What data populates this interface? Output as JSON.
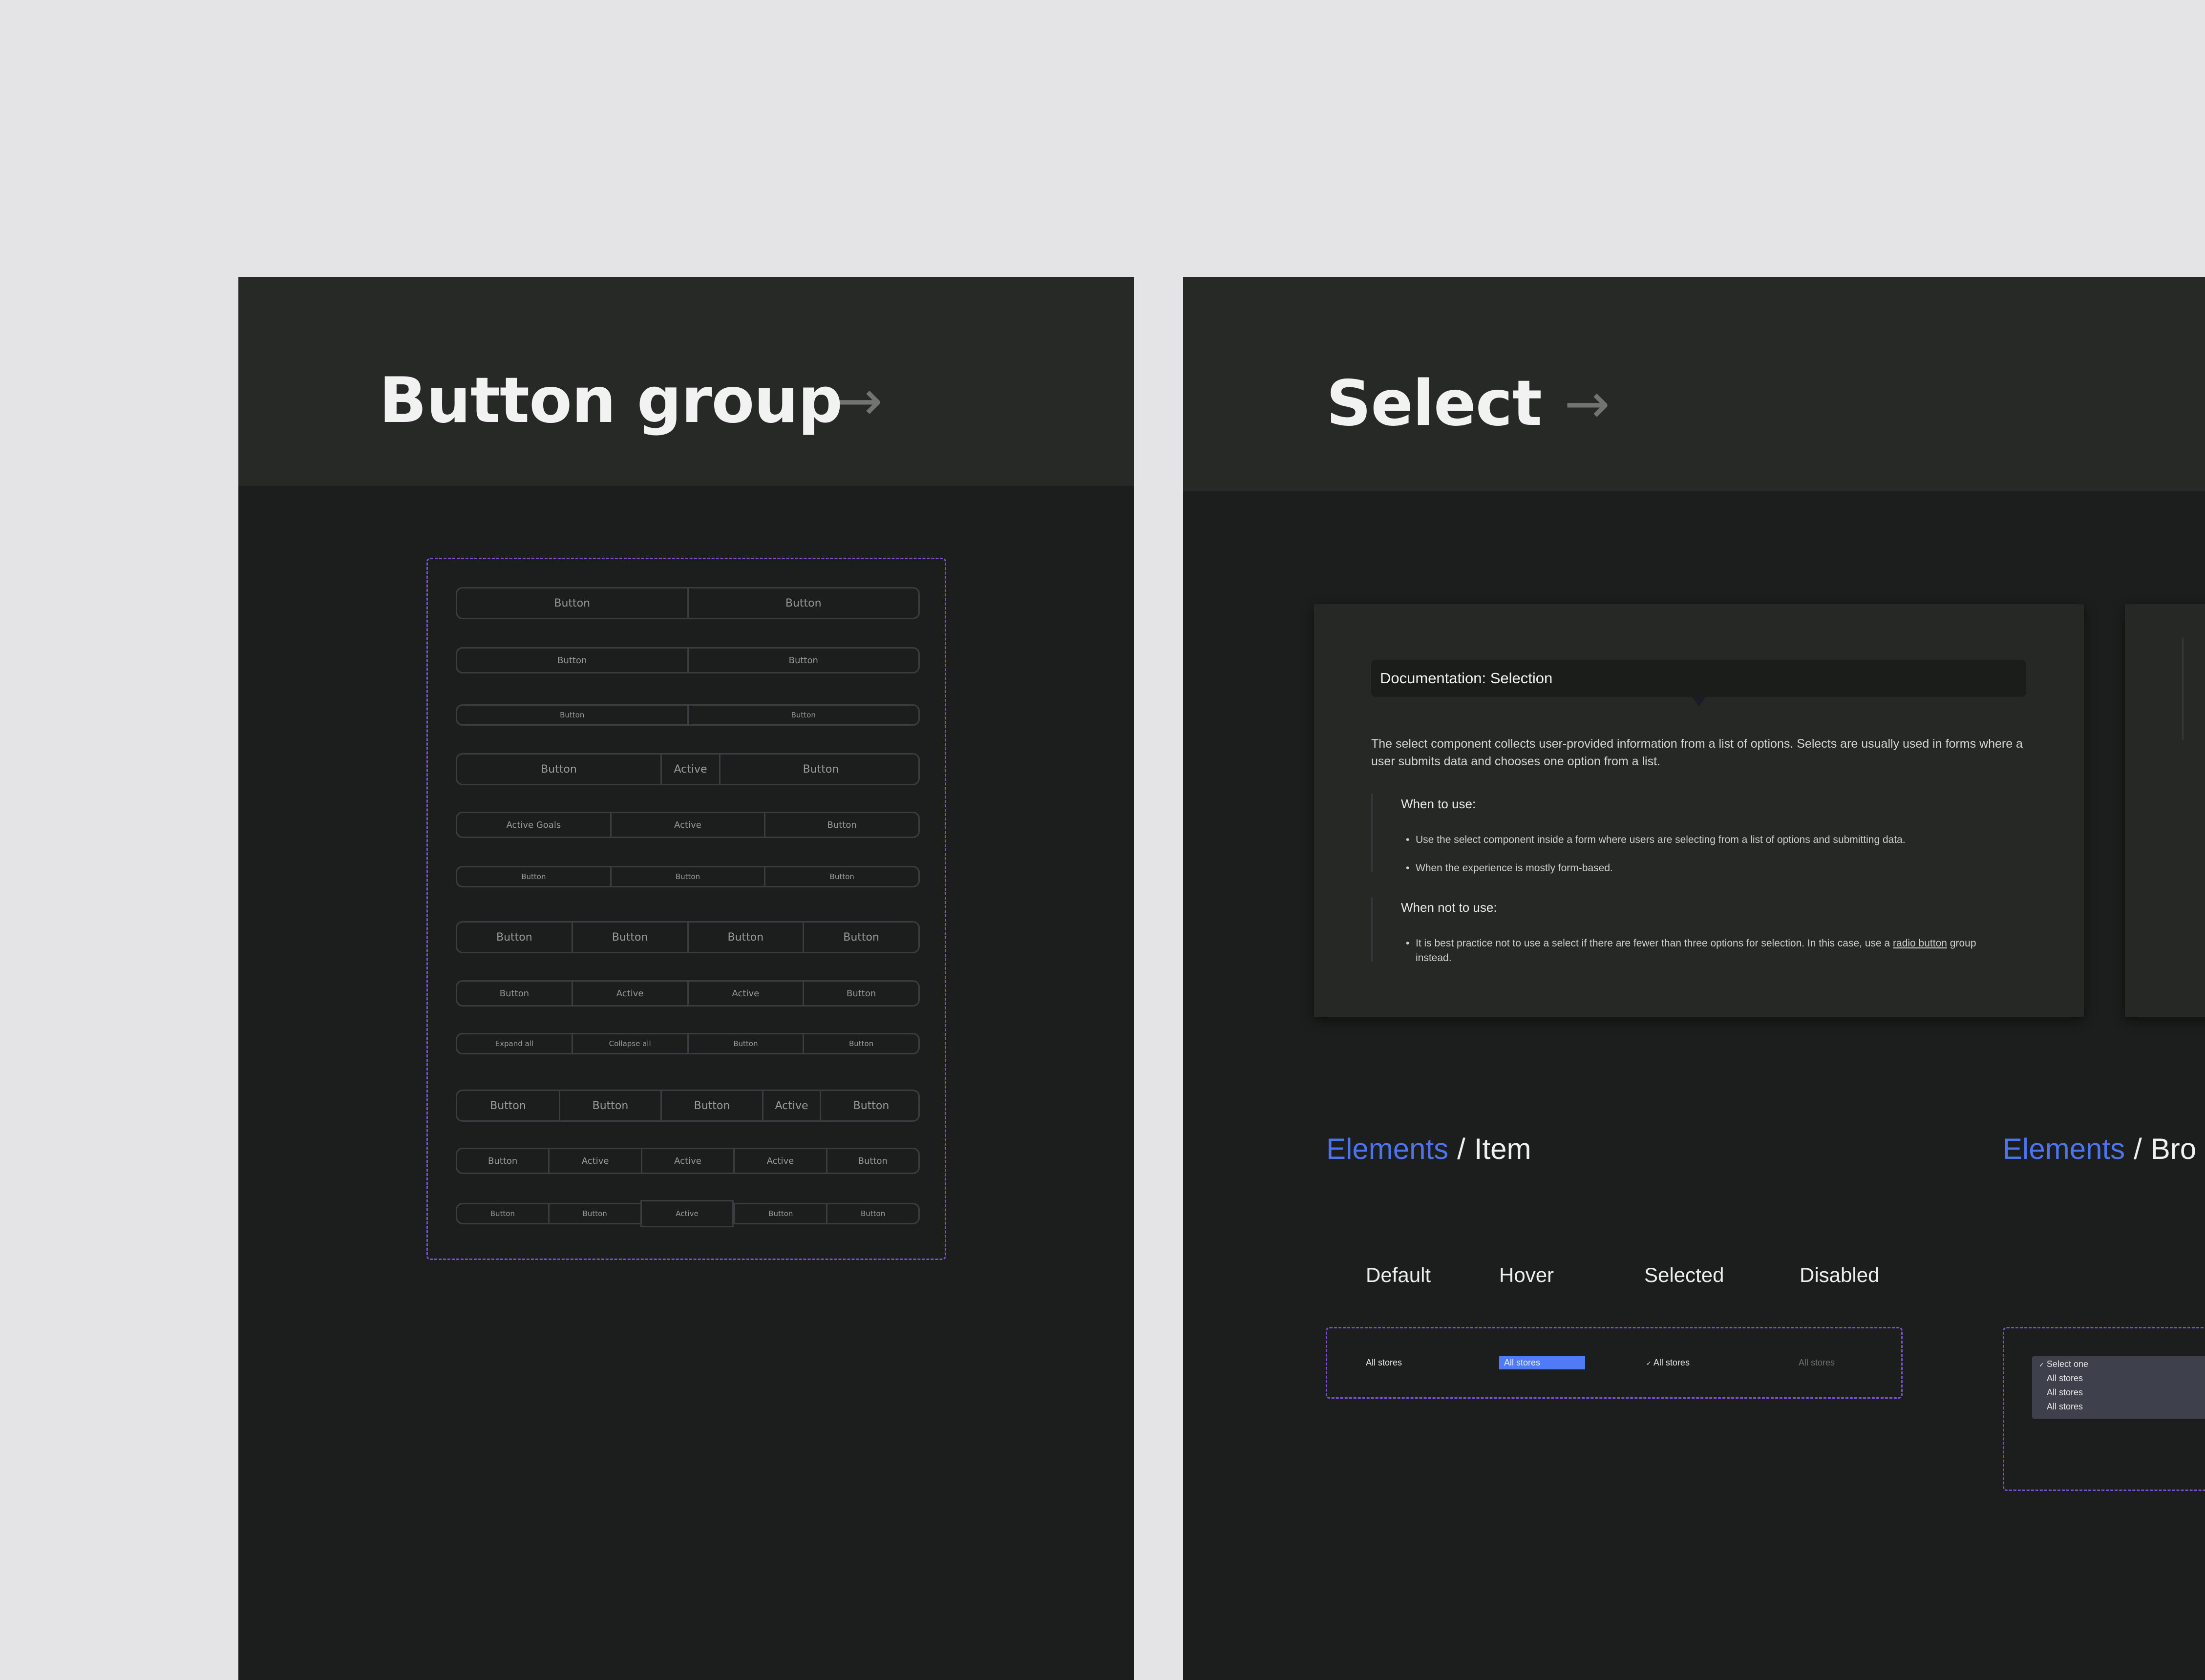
{
  "colors": {
    "canvas_bg": "#e4e4e6",
    "frame_bg": "#1b1e1c",
    "header_bg": "#262926",
    "accent_blue": "#4d74ee",
    "dashed_purple": "#7b4fd0",
    "hover_blue": "#4f7bf7"
  },
  "button_group_page": {
    "title": "Button group",
    "arrow_icon": "→",
    "rows": [
      {
        "size": "large",
        "segments": [
          "Button",
          "Button"
        ]
      },
      {
        "size": "medium",
        "segments": [
          "Button",
          "Button"
        ]
      },
      {
        "size": "small",
        "segments": [
          "Button",
          "Button"
        ]
      },
      {
        "size": "large",
        "segments": [
          "Button",
          "Active",
          "Button"
        ]
      },
      {
        "size": "medium",
        "segments": [
          "Active Goals",
          "Active",
          "Button"
        ]
      },
      {
        "size": "small",
        "segments": [
          "Button",
          "Button",
          "Button"
        ]
      },
      {
        "size": "large",
        "segments": [
          "Button",
          "Button",
          "Button",
          "Button"
        ]
      },
      {
        "size": "medium",
        "segments": [
          "Button",
          "Active",
          "Active",
          "Button"
        ]
      },
      {
        "size": "small",
        "segments": [
          "Expand all",
          "Collapse all",
          "Button",
          "Button"
        ]
      },
      {
        "size": "large",
        "segments": [
          "Button",
          "Button",
          "Button",
          "Active",
          "Button"
        ]
      },
      {
        "size": "medium",
        "segments": [
          "Button",
          "Active",
          "Active",
          "Active",
          "Button"
        ]
      },
      {
        "size": "small",
        "segments": [
          "Button",
          "Button",
          "Active",
          "Button",
          "Button"
        ]
      }
    ]
  },
  "select_page": {
    "title": "Select",
    "arrow_icon": "→",
    "doc_card": {
      "tooltip_title": "Documentation: Selection",
      "intro": "The select component collects user-provided information from a list of options. Selects are usually used in forms where a user submits data and chooses one option from a list.",
      "when_to_use": {
        "heading": "When to use:",
        "items": [
          "Use the select component inside a form where users are selecting from a list of options and submitting data.",
          "When the experience is mostly form-based."
        ]
      },
      "when_not_to_use": {
        "heading": "When not to use:",
        "item_before_link": "It is best practice not to use a select if there are fewer than three options for selection. In this case, use a ",
        "link_text": "radio button",
        "item_after_link": " group instead."
      }
    },
    "elements_item": {
      "breadcrumb_root": "Elements",
      "separator": "/",
      "name": "Item",
      "states": [
        "Default",
        "Hover",
        "Selected",
        "Disabled"
      ],
      "items": {
        "default": "All stores",
        "hover": "All stores",
        "selected_check": "✓",
        "selected": "All stores",
        "disabled": "All stores"
      }
    },
    "elements_browser": {
      "breadcrumb_root": "Elements",
      "separator": "/",
      "name": "Bro",
      "dropdown": {
        "check": "✓",
        "selected": "Select one",
        "options": [
          "All stores",
          "All stores",
          "All stores"
        ]
      }
    }
  }
}
